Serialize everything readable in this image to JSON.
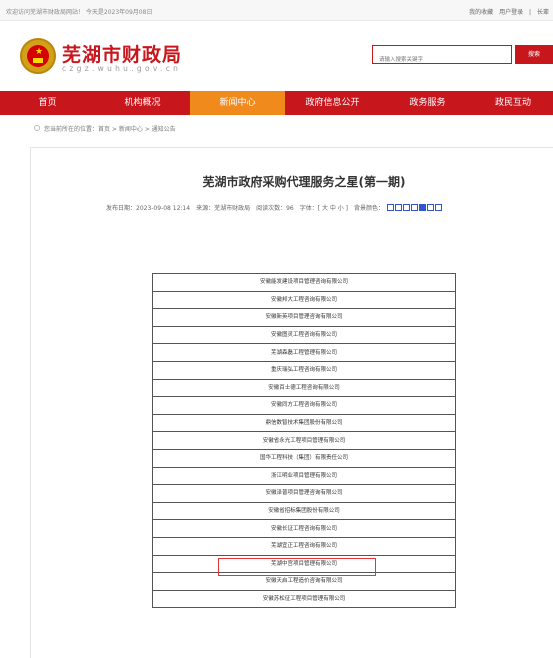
{
  "topbar": {
    "welcome": "欢迎访问芜湖市财政局网站！ 今天是2023年09月08日",
    "favorites": "我的收藏",
    "login": "用户登录",
    "separator": "|",
    "care": "长辈"
  },
  "header": {
    "logo_cn": "芜湖市财政局",
    "logo_en": "czgz.wuhu.gov.cn",
    "search_placeholder": "请输入搜索关键字",
    "search_button": "搜索"
  },
  "nav": [
    {
      "label": "首页",
      "active": false
    },
    {
      "label": "机构概况",
      "active": false
    },
    {
      "label": "新闻中心",
      "active": true
    },
    {
      "label": "政府信息公开",
      "active": false
    },
    {
      "label": "政务服务",
      "active": false
    },
    {
      "label": "政民互动",
      "active": false
    }
  ],
  "breadcrumb": "您当前所在的位置：首页 > 新闻中心 > 通知公告",
  "article": {
    "title": "芜湖市政府采购代理服务之星(第一期)",
    "meta": "发布日期：2023-09-08 12:14　来源：芜湖市财政局　阅读次数：96　字体：[ 大 中 小 ]　背景颜色："
  },
  "companies": [
    "安徽能发建设项目管理咨询有限公司",
    "安徽邦大工程咨询有限公司",
    "安徽新英项目管理咨询有限公司",
    "安徽图灵工程咨询有限公司",
    "芜湖森磊工程管理有限公司",
    "重庆瑞弘工程咨询有限公司",
    "安徽百士德工程咨询有限公司",
    "安徽同方工程咨询有限公司",
    "鼎信数智技术集团股份有限公司",
    "安徽省永光工程项目管理有限公司",
    "国华工程科技（集团）有限责任公司",
    "浙江明业项目管理有限公司",
    "安徽泽普项目管理咨询有限公司",
    "安徽省招标集团股份有限公司",
    "安徽长证工程咨询有限公司",
    "芜湖宜正工程咨询有限公司",
    "芜湖中宫项目管理有限公司",
    "安徽天启工程造价咨询有限公司",
    "安徽苏松征工程项目管理有限公司"
  ],
  "highlighted_row": 15,
  "colors": {
    "brand_red": "#c8161d",
    "active_orange": "#f08a1d",
    "highlight_red": "#e63333"
  }
}
